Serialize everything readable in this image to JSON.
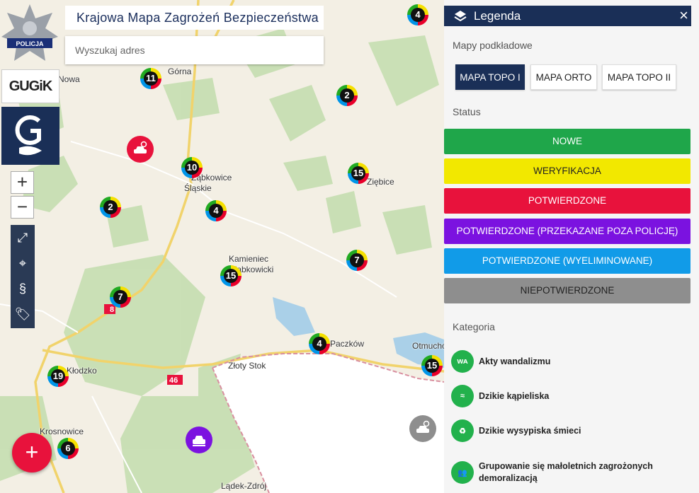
{
  "header": {
    "title": "Krajowa Mapa Zagrożeń Bezpieczeństwa"
  },
  "search": {
    "placeholder": "Wyszukaj adres"
  },
  "logos": {
    "police": "POLICJA",
    "gugik": "GUGiK"
  },
  "map": {
    "zoom_in": "+",
    "zoom_out": "−",
    "places": [
      "Górna",
      "Ząbkowice",
      "Śląskie",
      "Kamieniec",
      "Ząbkowicki",
      "Paczków",
      "Otmuchów",
      "Złoty Stok",
      "Kłodzko",
      "Krosnowice",
      "Lądek-Zdrój",
      "Ziębice",
      "Nowa"
    ],
    "road_labels": [
      "8",
      "46"
    ],
    "clusters": [
      "11",
      "2",
      "10",
      "15",
      "2",
      "4",
      "7",
      "15",
      "7",
      "4",
      "15",
      "19",
      "6",
      "4"
    ],
    "add_label": "+"
  },
  "legend": {
    "title": "Legenda",
    "close": "×",
    "basemaps_label": "Mapy podkładowe",
    "basemaps": [
      "MAPA TOPO I",
      "MAPA ORTO",
      "MAPA TOPO II"
    ],
    "status_label": "Status",
    "statuses": [
      {
        "label": "NOWE",
        "color": "#1fa64a",
        "text": "#ffffff"
      },
      {
        "label": "WERYFIKACJA",
        "color": "#f2e800",
        "text": "#222222"
      },
      {
        "label": "POTWIERDZONE",
        "color": "#e8123c",
        "text": "#ffffff"
      },
      {
        "label": "POTWIERDZONE (PRZEKAZANE POZA POLICJĘ)",
        "color": "#7b12e0",
        "text": "#ffffff"
      },
      {
        "label": "POTWIERDZONE (WYELIMINOWANE)",
        "color": "#119be8",
        "text": "#ffffff"
      },
      {
        "label": "NIEPOTWIERDZONE",
        "color": "#8e8e8e",
        "text": "#222222"
      }
    ],
    "category_label": "Kategoria",
    "categories": [
      "Akty wandalizmu",
      "Dzikie kąpieliska",
      "Dzikie wysypiska śmieci",
      "Grupowanie się małoletnich zagrożonych demoralizacją"
    ]
  }
}
